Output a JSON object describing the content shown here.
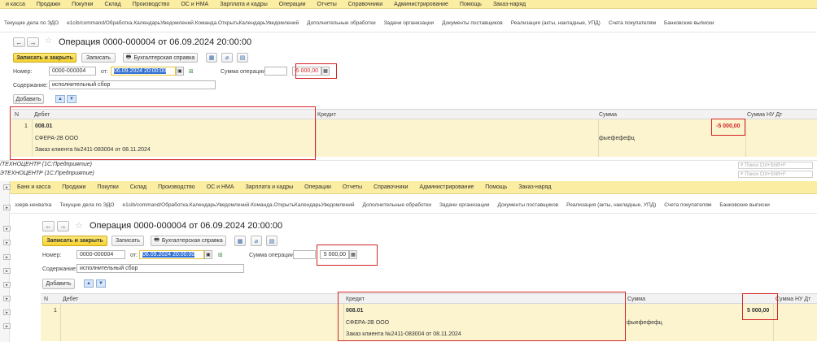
{
  "top": {
    "menu": [
      "и касса",
      "Продажи",
      "Покупки",
      "Склад",
      "Производство",
      "ОС и НМА",
      "Зарплата и кадры",
      "Операции",
      "Отчеты",
      "Справочники",
      "Администрирование",
      "Помощь",
      "Заказ-наряд"
    ],
    "tabs": [
      "Текущие дела по ЭДО",
      "e1cib/command/Обработка.КалендарьУведомлений.Команда.ОткрытьКалендарьУведомлений",
      "Дополнительные обработки",
      "Задачи организации",
      "Документы поставщиков",
      "Реализация (акты, накладные, УПД)",
      "Счета покупателям",
      "Банковские выписки"
    ],
    "search_placeholder": "Поиск Ctrl+Shift+F"
  },
  "doc": {
    "title": "Операция 0000-000004 от 06.09.2024 20:00:00",
    "save_close": "Записать и закрыть",
    "save": "Записать",
    "print": "Бухгалтерская справка",
    "number_label": "Номер:",
    "number_value": "0000-000004",
    "date_label": "от:",
    "date_value": "06.09.2024 20:00:00",
    "sum_label": "Сумма операции:",
    "content_label": "Содержание:",
    "content_value": "исполнительный сбор",
    "add_button": "Добавить",
    "col_n": "N",
    "col_debit": "Дебет",
    "col_credit": "Кредит",
    "col_sum": "Сумма",
    "col_sum_nu": "Сумма НУ Дт",
    "row_n": "1",
    "account": "008.01",
    "counterparty": "СФЕРА-2В ООО",
    "order": "Заказ клиента №2411-083004 от 08.11.2024",
    "comment": "фыефефефц"
  },
  "top_doc": {
    "sum_value": "-5 000,00",
    "row_sum": "-5 000,00"
  },
  "window": {
    "line1": "/ТЕХНОЦЕНТР (1С:Предприятие)",
    "line2": "ЭТЕХНОЦЕНТР (1С:Предприятие)",
    "search1": "Поиск Ctrl+Shift+F",
    "search2": "Поиск Ctrl+Shift+F"
  },
  "bottom": {
    "menu": [
      "Банк и касса",
      "Продажи",
      "Покупки",
      "Склад",
      "Производство",
      "ОС и НМА",
      "Зарплата и кадры",
      "Операции",
      "Отчеты",
      "Справочники",
      "Администрирование",
      "Помощь",
      "Заказ-наряд"
    ],
    "tabs": [
      "ззерв-нехватка",
      "Текущие дела по ЭДО",
      "e1cib/command/Обработка.КалендарьУведомлений.Команда.ОткрытьКалендарьУведомлений",
      "Дополнительные обработки",
      "Задачи организации",
      "Документы поставщиков",
      "Реализация (акты, накладные, УПД)",
      "Счета покупателям",
      "Банковские выписки"
    ]
  },
  "bottom_doc": {
    "sum_value": "5 000,00",
    "row_sum": "5 000,00"
  },
  "colors": {
    "menu_bg": "#fbeda1",
    "row_bg": "#fbf4cf",
    "highlight": "#d42424",
    "primary": "#f6d22e"
  }
}
